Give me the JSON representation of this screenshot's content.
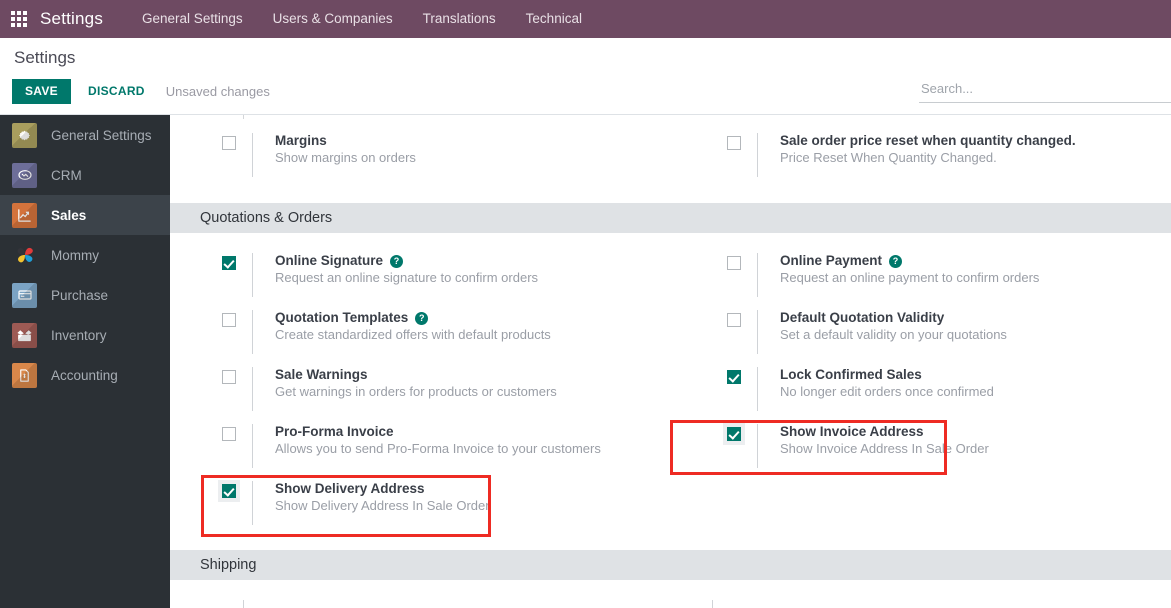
{
  "navbar": {
    "apps_icon": "apps-grid-icon",
    "brand": "Settings",
    "links": [
      {
        "label": "General Settings"
      },
      {
        "label": "Users & Companies"
      },
      {
        "label": "Translations"
      },
      {
        "label": "Technical"
      }
    ]
  },
  "control_panel": {
    "title": "Settings",
    "save_label": "SAVE",
    "discard_label": "DISCARD",
    "status_text": "Unsaved changes",
    "search_placeholder": "Search...",
    "search_value": ""
  },
  "sidebar": {
    "items": [
      {
        "label": "General Settings",
        "icon": "gear-icon",
        "active": false
      },
      {
        "label": "CRM",
        "icon": "handshake-icon",
        "active": false
      },
      {
        "label": "Sales",
        "icon": "chart-line-icon",
        "active": true
      },
      {
        "label": "Mommy",
        "icon": "pinwheel-icon",
        "active": false
      },
      {
        "label": "Purchase",
        "icon": "credit-card-icon",
        "active": false
      },
      {
        "label": "Inventory",
        "icon": "open-box-icon",
        "active": false
      },
      {
        "label": "Accounting",
        "icon": "invoice-document-icon",
        "active": false
      }
    ]
  },
  "main": {
    "pre_section_rows": [
      {
        "title": "Margins",
        "desc": "Show margins on orders",
        "checked": false,
        "help": false,
        "highlighted": false
      },
      {
        "title": "Sale order price reset when quantity changed.",
        "desc": "Price Reset When Quantity Changed.",
        "checked": false,
        "help": false,
        "highlighted": false
      }
    ],
    "sections": [
      {
        "name": "Quotations & Orders",
        "rows": [
          {
            "title": "Online Signature",
            "desc": "Request an online signature to confirm orders",
            "checked": true,
            "help": true,
            "highlighted": false
          },
          {
            "title": "Online Payment",
            "desc": "Request an online payment to confirm orders",
            "checked": false,
            "help": true,
            "highlighted": false
          },
          {
            "title": "Quotation Templates",
            "desc": "Create standardized offers with default products",
            "checked": false,
            "help": true,
            "highlighted": false
          },
          {
            "title": "Default Quotation Validity",
            "desc": "Set a default validity on your quotations",
            "checked": false,
            "help": false,
            "highlighted": false
          },
          {
            "title": "Sale Warnings",
            "desc": "Get warnings in orders for products or customers",
            "checked": false,
            "help": false,
            "highlighted": false
          },
          {
            "title": "Lock Confirmed Sales",
            "desc": "No longer edit orders once confirmed",
            "checked": true,
            "help": false,
            "highlighted": false
          },
          {
            "title": "Pro-Forma Invoice",
            "desc": "Allows you to send Pro-Forma Invoice to your customers",
            "checked": false,
            "help": false,
            "highlighted": false
          },
          {
            "title": "Show Invoice Address",
            "desc": "Show Invoice Address In Sale Order",
            "checked": true,
            "help": false,
            "highlighted": true
          },
          {
            "title": "Show Delivery Address",
            "desc": "Show Delivery Address In Sale Order",
            "checked": true,
            "help": true,
            "highlighted": true
          },
          {
            "title": "",
            "desc": "",
            "checked": false,
            "help": false,
            "highlighted": false
          }
        ]
      },
      {
        "name": "Shipping",
        "rows": []
      }
    ],
    "help_glyph": "?"
  },
  "colors": {
    "navbar": "#6E4A62",
    "accent_teal": "#00786B",
    "sidebar_bg": "#2B3035",
    "sidebar_active": "#3C434A",
    "section_band": "#DFE2E5",
    "annotation_red": "#EE2B23"
  }
}
